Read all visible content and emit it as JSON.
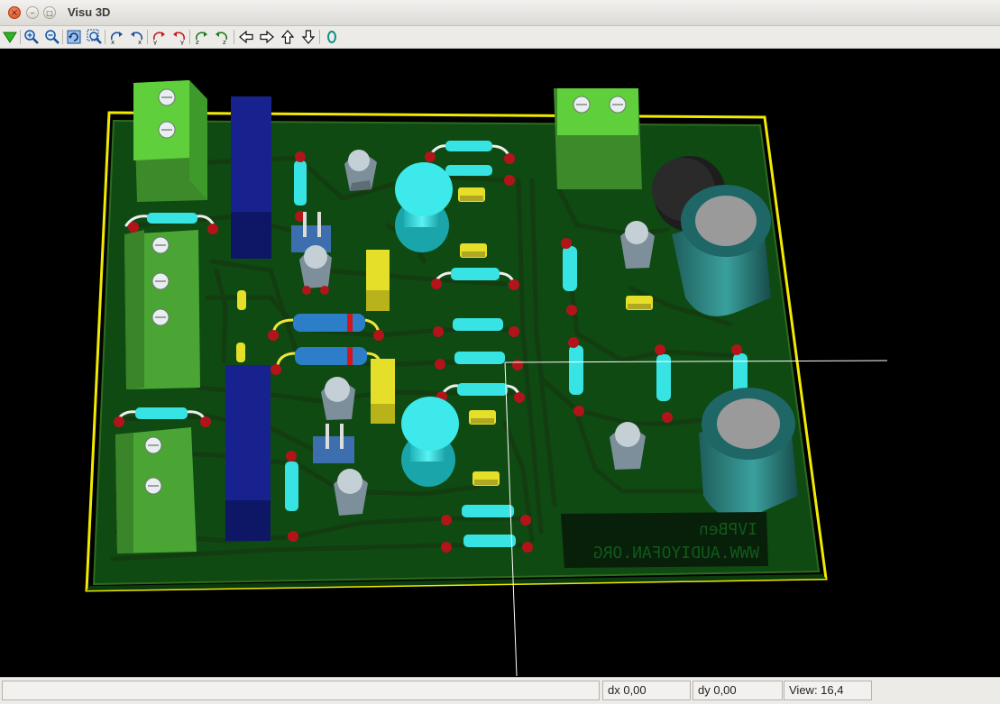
{
  "window": {
    "title": "Visu 3D",
    "close_glyph": "×",
    "min_glyph": "–",
    "max_glyph": "□"
  },
  "toolbar": {
    "buttons": [
      {
        "name": "reload-3d-button",
        "icon": "green-arrow-down-icon"
      },
      {
        "name": "zoom-in-button",
        "icon": "zoom-in-icon"
      },
      {
        "name": "zoom-out-button",
        "icon": "zoom-out-icon"
      },
      {
        "name": "redraw-button",
        "icon": "redraw-icon"
      },
      {
        "name": "zoom-fit-button",
        "icon": "zoom-fit-icon"
      },
      {
        "name": "rotate-x-neg-button",
        "icon": "rotate-x-neg-icon"
      },
      {
        "name": "rotate-x-pos-button",
        "icon": "rotate-x-pos-icon"
      },
      {
        "name": "rotate-y-neg-button",
        "icon": "rotate-y-neg-icon"
      },
      {
        "name": "rotate-y-pos-button",
        "icon": "rotate-y-pos-icon"
      },
      {
        "name": "rotate-z-neg-button",
        "icon": "rotate-z-neg-icon"
      },
      {
        "name": "rotate-z-pos-button",
        "icon": "rotate-z-pos-icon"
      },
      {
        "name": "move-left-button",
        "icon": "arrow-left-icon"
      },
      {
        "name": "move-right-button",
        "icon": "arrow-right-icon"
      },
      {
        "name": "move-up-button",
        "icon": "arrow-up-icon"
      },
      {
        "name": "move-down-button",
        "icon": "arrow-down-icon"
      },
      {
        "name": "ortho-toggle-button",
        "icon": "ortho-icon"
      }
    ]
  },
  "board": {
    "silkscreen_line1": "IVPBen",
    "silkscreen_line2": "WWW.AUDIYOFAN.ORG",
    "colors": {
      "pcb": "#0e4a12",
      "outline": "#f2ea00",
      "trace": "#123a10",
      "resistor": "#33e0e0",
      "terminal": "#5fcf3c",
      "ic": "#101a78",
      "capacitor": "#2e8a88"
    }
  },
  "status": {
    "left": "",
    "dx": "dx 0,00",
    "dy": "dy 0,00",
    "view": "View: 16,4"
  }
}
